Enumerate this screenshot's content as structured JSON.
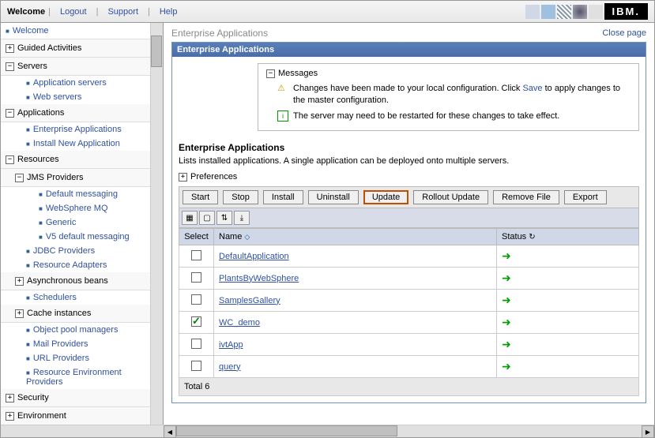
{
  "topnav": {
    "welcome": "Welcome",
    "logout": "Logout",
    "support": "Support",
    "help": "Help",
    "logo": "IBM."
  },
  "sidebar": {
    "welcome": "Welcome",
    "guided": "Guided Activities",
    "servers": {
      "label": "Servers",
      "app_servers": "Application servers",
      "web_servers": "Web servers"
    },
    "applications": {
      "label": "Applications",
      "enterprise": "Enterprise Applications",
      "install": "Install New Application"
    },
    "resources": {
      "label": "Resources",
      "jms": {
        "label": "JMS Providers",
        "default": "Default messaging",
        "mq": "WebSphere MQ",
        "generic": "Generic",
        "v5": "V5 default messaging"
      },
      "jdbc": "JDBC Providers",
      "adapters": "Resource Adapters",
      "async": "Asynchronous beans",
      "schedulers": "Schedulers",
      "cache": "Cache instances",
      "pool": "Object pool managers",
      "mail": "Mail Providers",
      "url": "URL Providers",
      "env": "Resource Environment Providers"
    },
    "security": "Security",
    "environment": "Environment"
  },
  "page": {
    "breadcrumb": "Enterprise Applications",
    "close": "Close page",
    "panel_title": "Enterprise Applications",
    "messages": {
      "title": "Messages",
      "warn_pre": "Changes have been made to your local configuration. Click ",
      "save": "Save",
      "warn_post": " to apply changes to the master configuration.",
      "info": "The server may need to be restarted for these changes to take effect."
    },
    "section_title": "Enterprise Applications",
    "section_desc": "Lists installed applications. A single application can be deployed onto multiple servers.",
    "preferences": "Preferences",
    "buttons": {
      "start": "Start",
      "stop": "Stop",
      "install": "Install",
      "uninstall": "Uninstall",
      "update": "Update",
      "rollout": "Rollout Update",
      "remove": "Remove File",
      "export": "Export"
    },
    "table": {
      "select": "Select",
      "name": "Name",
      "status": "Status",
      "rows": [
        {
          "name": "DefaultApplication",
          "checked": false
        },
        {
          "name": "PlantsByWebSphere",
          "checked": false
        },
        {
          "name": "SamplesGallery",
          "checked": false
        },
        {
          "name": "WC_demo",
          "checked": true
        },
        {
          "name": "ivtApp",
          "checked": false
        },
        {
          "name": "query",
          "checked": false
        }
      ],
      "total": "Total 6"
    }
  }
}
